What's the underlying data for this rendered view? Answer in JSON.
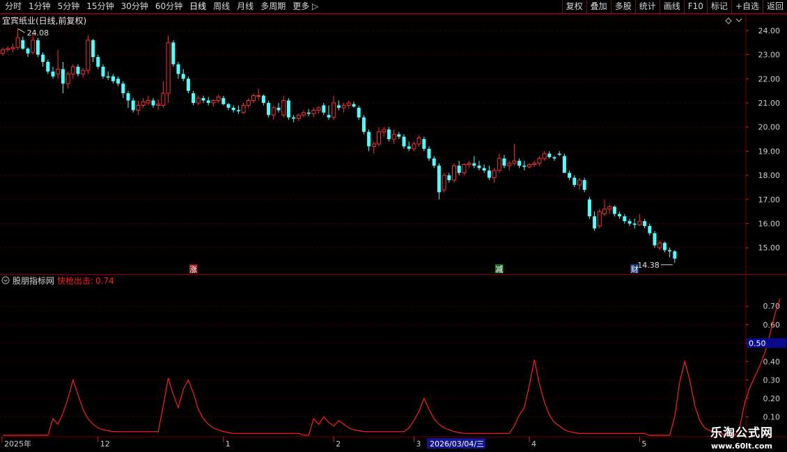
{
  "toolbar": {
    "periods": [
      "分时",
      "1分钟",
      "5分钟",
      "15分钟",
      "30分钟",
      "60分钟",
      "日线",
      "周线",
      "月线",
      "多周期",
      "更多 ▷"
    ],
    "active_period": "日线",
    "actions": [
      "复权",
      "叠加",
      "多股",
      "统计",
      "画线",
      "F10",
      "标记",
      "+自选",
      "返回"
    ]
  },
  "main_chart": {
    "title": "宜宾纸业(日线,前复权)",
    "high_label": "24.08",
    "low_label": "14.38",
    "price_axis": [
      "24.00",
      "23.00",
      "22.00",
      "21.00",
      "20.00",
      "19.00",
      "18.00",
      "17.00",
      "16.00",
      "15.00"
    ],
    "markers": [
      {
        "text": "涨",
        "color": "#8b1a1a"
      },
      {
        "text": "减",
        "color": "#1f6b2a"
      },
      {
        "text": "财",
        "color": "#1d3a7a"
      }
    ]
  },
  "indicator": {
    "name": "股朋指标网",
    "line_label": "快枪出击:",
    "line_value": "0.74",
    "axis": [
      "0.70",
      "0.60",
      "0.50",
      "0.40",
      "0.30",
      "0.20",
      "0.10"
    ],
    "reference_value": "0.50"
  },
  "date_axis": {
    "labels": [
      "2025年",
      "12",
      "1",
      "2",
      "3",
      "4",
      "5"
    ],
    "cursor_date": "2026/03/04/三"
  },
  "watermark": {
    "title": "乐淘公式网",
    "url": "www.60lt.com"
  },
  "colors": {
    "up": "#ff3232",
    "down": "#54ffff",
    "grid": "#7a0000",
    "indicator": "#ff2020"
  },
  "chart_data": {
    "type": "candlestick",
    "ohlc": [
      [
        23.05,
        23.3,
        22.95,
        23.2
      ],
      [
        23.2,
        23.35,
        23.1,
        23.25
      ],
      [
        23.25,
        23.45,
        23.1,
        23.3
      ],
      [
        23.3,
        24.08,
        23.2,
        23.7
      ],
      [
        23.6,
        23.75,
        23.2,
        23.25
      ],
      [
        23.25,
        23.3,
        22.9,
        23.05
      ],
      [
        23.1,
        23.9,
        23.0,
        23.6
      ],
      [
        23.6,
        23.7,
        22.9,
        23.0
      ],
      [
        23.0,
        23.1,
        22.5,
        22.7
      ],
      [
        22.7,
        22.8,
        22.2,
        22.3
      ],
      [
        22.3,
        22.5,
        22.0,
        22.1
      ],
      [
        22.2,
        23.2,
        22.0,
        22.4
      ],
      [
        22.4,
        22.7,
        21.4,
        21.8
      ],
      [
        21.8,
        22.3,
        21.6,
        22.2
      ],
      [
        22.2,
        22.6,
        22.0,
        22.5
      ],
      [
        22.5,
        22.6,
        22.1,
        22.2
      ],
      [
        22.2,
        22.45,
        22.05,
        22.35
      ],
      [
        22.35,
        23.8,
        22.2,
        23.6
      ],
      [
        23.6,
        23.65,
        22.7,
        22.9
      ],
      [
        22.9,
        23.0,
        22.4,
        22.5
      ],
      [
        22.5,
        22.6,
        22.0,
        22.1
      ],
      [
        22.1,
        22.3,
        21.95,
        22.05
      ],
      [
        22.1,
        22.2,
        21.8,
        21.9
      ],
      [
        22.0,
        22.1,
        21.7,
        21.8
      ],
      [
        21.8,
        21.9,
        21.2,
        21.4
      ],
      [
        21.4,
        21.5,
        20.8,
        21.1
      ],
      [
        21.1,
        21.2,
        20.6,
        20.7
      ],
      [
        20.7,
        21.1,
        20.5,
        20.9
      ],
      [
        20.9,
        21.2,
        20.8,
        21.05
      ],
      [
        21.0,
        21.3,
        20.9,
        21.1
      ],
      [
        21.1,
        21.2,
        20.8,
        20.9
      ],
      [
        20.9,
        21.15,
        20.7,
        20.95
      ],
      [
        20.9,
        21.9,
        20.8,
        21.4
      ],
      [
        21.4,
        23.8,
        21.0,
        23.5
      ],
      [
        23.5,
        23.6,
        22.5,
        22.6
      ],
      [
        22.6,
        22.7,
        22.0,
        22.2
      ],
      [
        22.2,
        22.4,
        21.9,
        22.0
      ],
      [
        22.0,
        22.1,
        21.4,
        21.5
      ],
      [
        21.4,
        21.5,
        20.9,
        21.0
      ],
      [
        21.0,
        21.3,
        20.9,
        21.2
      ],
      [
        21.2,
        21.3,
        21.0,
        21.1
      ],
      [
        21.1,
        21.25,
        20.9,
        21.0
      ],
      [
        21.0,
        21.15,
        20.85,
        21.1
      ],
      [
        21.1,
        21.35,
        21.0,
        21.25
      ],
      [
        21.2,
        21.3,
        20.9,
        20.95
      ],
      [
        20.95,
        21.0,
        20.7,
        20.8
      ],
      [
        20.8,
        20.9,
        20.6,
        20.7
      ],
      [
        20.7,
        20.9,
        20.55,
        20.65
      ],
      [
        20.6,
        21.0,
        20.55,
        20.9
      ],
      [
        20.9,
        21.2,
        20.8,
        21.1
      ],
      [
        21.1,
        21.4,
        21.0,
        21.3
      ],
      [
        21.3,
        21.6,
        21.1,
        21.3
      ],
      [
        21.3,
        21.35,
        20.9,
        21.0
      ],
      [
        21.0,
        21.1,
        20.4,
        20.5
      ],
      [
        20.5,
        20.9,
        20.3,
        20.8
      ],
      [
        20.8,
        21.0,
        20.6,
        20.7
      ],
      [
        20.5,
        21.3,
        20.4,
        21.1
      ],
      [
        21.1,
        21.2,
        20.3,
        20.4
      ],
      [
        20.4,
        20.5,
        20.2,
        20.35
      ],
      [
        20.35,
        20.55,
        20.25,
        20.5
      ],
      [
        20.5,
        20.7,
        20.4,
        20.6
      ],
      [
        20.6,
        20.75,
        20.45,
        20.55
      ],
      [
        20.55,
        20.8,
        20.4,
        20.7
      ],
      [
        20.7,
        20.85,
        20.55,
        20.8
      ],
      [
        20.9,
        21.0,
        20.5,
        20.6
      ],
      [
        20.5,
        20.9,
        20.3,
        20.4
      ],
      [
        20.4,
        21.3,
        20.3,
        21.0
      ],
      [
        20.9,
        21.1,
        20.7,
        20.8
      ],
      [
        20.8,
        21.0,
        20.6,
        20.9
      ],
      [
        20.9,
        21.1,
        20.75,
        21.0
      ],
      [
        20.95,
        21.05,
        20.8,
        20.85
      ],
      [
        20.8,
        20.9,
        20.3,
        20.4
      ],
      [
        20.4,
        20.5,
        19.7,
        19.8
      ],
      [
        19.8,
        19.9,
        19.0,
        19.2
      ],
      [
        19.2,
        19.4,
        18.9,
        19.3
      ],
      [
        19.3,
        20.0,
        19.2,
        19.8
      ],
      [
        19.8,
        20.0,
        19.6,
        19.9
      ],
      [
        19.9,
        20.0,
        19.4,
        19.5
      ],
      [
        19.5,
        19.9,
        19.3,
        19.7
      ],
      [
        19.7,
        19.8,
        19.5,
        19.6
      ],
      [
        19.6,
        19.7,
        19.1,
        19.2
      ],
      [
        19.2,
        19.4,
        19.0,
        19.1
      ],
      [
        19.1,
        19.4,
        19.0,
        19.3
      ],
      [
        19.3,
        19.65,
        19.2,
        19.55
      ],
      [
        19.5,
        19.6,
        19.0,
        19.1
      ],
      [
        19.1,
        19.2,
        18.6,
        18.7
      ],
      [
        18.7,
        18.8,
        18.3,
        18.4
      ],
      [
        18.4,
        18.5,
        17.0,
        17.3
      ],
      [
        17.4,
        18.1,
        17.3,
        18.0
      ],
      [
        18.0,
        18.1,
        17.7,
        17.8
      ],
      [
        17.8,
        18.5,
        17.7,
        18.4
      ],
      [
        18.4,
        18.6,
        18.0,
        18.1
      ],
      [
        18.1,
        18.5,
        18.0,
        18.45
      ],
      [
        18.45,
        18.6,
        18.3,
        18.5
      ],
      [
        18.5,
        18.8,
        18.3,
        18.4
      ],
      [
        18.4,
        18.6,
        18.2,
        18.3
      ],
      [
        18.3,
        18.45,
        18.1,
        18.2
      ],
      [
        18.2,
        18.4,
        17.8,
        17.9
      ],
      [
        17.9,
        18.3,
        17.7,
        18.2
      ],
      [
        18.2,
        18.9,
        18.1,
        18.7
      ],
      [
        18.7,
        18.85,
        18.3,
        18.4
      ],
      [
        18.4,
        18.6,
        18.2,
        18.5
      ],
      [
        18.5,
        19.3,
        18.4,
        18.6
      ],
      [
        18.6,
        18.7,
        18.3,
        18.4
      ],
      [
        18.4,
        18.6,
        18.2,
        18.35
      ],
      [
        18.35,
        18.5,
        18.3,
        18.45
      ],
      [
        18.45,
        18.6,
        18.35,
        18.5
      ],
      [
        18.5,
        18.8,
        18.4,
        18.7
      ],
      [
        18.7,
        19.0,
        18.6,
        18.9
      ],
      [
        18.9,
        19.0,
        18.7,
        18.75
      ],
      [
        18.75,
        18.8,
        18.6,
        18.7
      ],
      [
        18.9,
        19.0,
        18.8,
        18.85
      ],
      [
        18.8,
        18.9,
        18.3,
        18.1
      ],
      [
        18.1,
        18.2,
        17.8,
        17.9
      ],
      [
        17.9,
        18.0,
        17.5,
        17.6
      ],
      [
        17.6,
        17.9,
        17.4,
        17.8
      ],
      [
        17.8,
        17.9,
        17.3,
        17.4
      ],
      [
        17.0,
        17.1,
        16.2,
        16.3
      ],
      [
        16.3,
        16.5,
        15.7,
        15.8
      ],
      [
        15.9,
        16.6,
        15.8,
        16.5
      ],
      [
        16.4,
        17.0,
        16.3,
        16.6
      ],
      [
        16.6,
        16.8,
        16.4,
        16.7
      ],
      [
        16.7,
        16.75,
        16.3,
        16.4
      ],
      [
        16.4,
        16.5,
        16.2,
        16.3
      ],
      [
        16.3,
        16.4,
        16.0,
        16.1
      ],
      [
        16.1,
        16.2,
        15.9,
        16.0
      ],
      [
        16.0,
        16.2,
        15.8,
        15.95
      ],
      [
        15.95,
        16.4,
        15.9,
        16.1
      ],
      [
        16.1,
        16.2,
        15.8,
        15.9
      ],
      [
        15.9,
        16.0,
        15.5,
        15.6
      ],
      [
        15.6,
        15.7,
        15.0,
        15.1
      ],
      [
        15.0,
        15.3,
        14.9,
        15.2
      ],
      [
        15.2,
        15.25,
        14.8,
        14.9
      ],
      [
        14.9,
        15.0,
        14.6,
        14.85
      ],
      [
        14.85,
        14.9,
        14.38,
        14.55
      ]
    ],
    "price_range": [
      14.2,
      24.4
    ],
    "indicator_series": {
      "name": "快枪出击",
      "values": [
        0.0,
        0.0,
        0.0,
        0.0,
        0.0,
        0.0,
        0.0,
        0.0,
        0.0,
        0.0,
        0.09,
        0.06,
        0.12,
        0.2,
        0.3,
        0.22,
        0.14,
        0.09,
        0.06,
        0.04,
        0.03,
        0.025,
        0.02,
        0.02,
        0.02,
        0.02,
        0.02,
        0.02,
        0.02,
        0.02,
        0.02,
        0.02,
        0.16,
        0.31,
        0.22,
        0.15,
        0.25,
        0.3,
        0.23,
        0.14,
        0.09,
        0.06,
        0.04,
        0.03,
        0.02,
        0.015,
        0.01,
        0.01,
        0.01,
        0.01,
        0.01,
        0.01,
        0.01,
        0.01,
        0.01,
        0.01,
        0.01,
        0.01,
        0.01,
        0.01,
        0.0,
        0.0,
        0.09,
        0.06,
        0.1,
        0.07,
        0.05,
        0.08,
        0.06,
        0.04,
        0.03,
        0.025,
        0.02,
        0.02,
        0.02,
        0.02,
        0.02,
        0.02,
        0.02,
        0.02,
        0.02,
        0.04,
        0.08,
        0.13,
        0.2,
        0.14,
        0.09,
        0.06,
        0.04,
        0.03,
        0.02,
        0.015,
        0.01,
        0.01,
        0.01,
        0.01,
        0.01,
        0.01,
        0.01,
        0.01,
        0.01,
        0.01,
        0.05,
        0.11,
        0.15,
        0.27,
        0.41,
        0.28,
        0.18,
        0.11,
        0.07,
        0.05,
        0.03,
        0.02,
        0.015,
        0.01,
        0.01,
        0.01,
        0.01,
        0.01,
        0.01,
        0.01,
        0.01,
        0.01,
        0.01,
        0.01,
        0.01,
        0.01,
        0.01,
        0.0,
        0.0,
        0.0,
        0.0,
        0.0,
        0.1,
        0.29,
        0.4,
        0.3,
        0.16,
        0.08,
        0.04,
        0.025,
        0.02,
        0.015,
        0.0,
        0.0,
        0.0,
        0.05,
        0.18,
        0.26,
        0.32,
        0.38,
        0.45,
        0.55,
        0.66,
        0.74
      ],
      "range": [
        0.0,
        0.78
      ]
    }
  }
}
